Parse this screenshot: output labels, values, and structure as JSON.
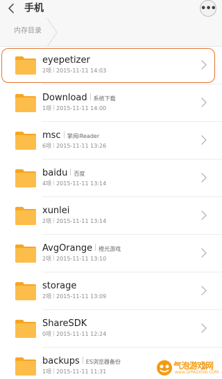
{
  "header": {
    "title": "手机",
    "back_icon": "chevron-left-icon",
    "more_label": "•••"
  },
  "breadcrumb": {
    "items": [
      "内存目录"
    ]
  },
  "colors": {
    "folder": "#fdbd4a",
    "highlight": "#e8742e",
    "watermark": "#f39c12"
  },
  "files": [
    {
      "name": "eyepetizer",
      "alias": "",
      "count": "2项",
      "date": "2015-11-11 14:03"
    },
    {
      "name": "Download",
      "alias": "系统下载",
      "count": "1项",
      "date": "2015-11-11 14:00"
    },
    {
      "name": "msc",
      "alias": "掌阅iReader",
      "count": "6项",
      "date": "2015-11-11 13:26"
    },
    {
      "name": "baidu",
      "alias": "百度",
      "count": "4项",
      "date": "2015-11-11 13:14"
    },
    {
      "name": "xunlei",
      "alias": "",
      "count": "2项",
      "date": "2015-11-11 13:14"
    },
    {
      "name": "AvgOrange",
      "alias": "橙光游戏",
      "count": "2项",
      "date": "2015-11-11 13:10"
    },
    {
      "name": "storage",
      "alias": "",
      "count": "2项",
      "date": "2015-11-11 13:09"
    },
    {
      "name": "ShareSDK",
      "alias": "",
      "count": "0项",
      "date": "2015-11-11 12:24"
    },
    {
      "name": "backups",
      "alias": "ES浏览器备份",
      "count": "1项",
      "date": "2015-11-11 11:31"
    }
  ],
  "watermark": {
    "text": "气泡游戏网",
    "url": "www.QIPAOXUN.COM"
  }
}
